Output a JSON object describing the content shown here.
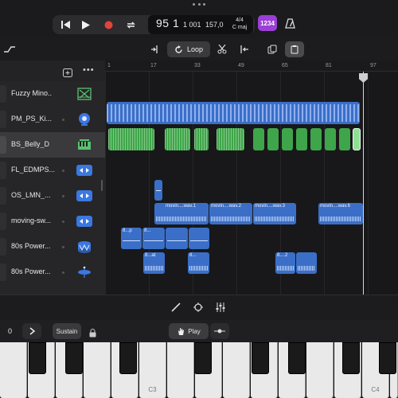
{
  "app": {
    "lcd": {
      "position": "95 1",
      "sub_beat": "1 001",
      "tempo": "157,0",
      "signature_top": "4/4",
      "signature_key": "C maj"
    },
    "count_in_label": "1234"
  },
  "toolbar": {
    "loop_label": "Loop"
  },
  "tracks": [
    {
      "name": "Fuzzy Mino..",
      "icon": "synth-icon"
    },
    {
      "name": "PM_PS_Ki...",
      "icon": "drum-machine-icon"
    },
    {
      "name": "BS_Belly_D",
      "icon": "keyboard-icon"
    },
    {
      "name": "FL_EDMPS...",
      "icon": "audio-waveform-icon"
    },
    {
      "name": "OS_LMN_...",
      "icon": "audio-waveform-icon"
    },
    {
      "name": "moving-sw...",
      "icon": "audio-waveform-icon"
    },
    {
      "name": "80s Power...",
      "icon": "snare-drum-icon"
    },
    {
      "name": "80s Power...",
      "icon": "cymbal-icon"
    }
  ],
  "ruler": [
    "1",
    "17",
    "33",
    "49",
    "65",
    "81",
    "97"
  ],
  "regions": {
    "moving": [
      "movin....wav.1",
      "movin....wav.2",
      "movin....wav.3",
      "movin....wav.6"
    ],
    "power1": [
      "8...p",
      "8..."
    ],
    "power2": [
      "8...at",
      "8...",
      "8....2"
    ]
  },
  "keyboard_controls": {
    "octave_value": "0",
    "sustain_label": "Sustain",
    "play_label": "Play"
  },
  "keyboard": {
    "c3_label": "C3",
    "c4_label": "C4"
  },
  "colors": {
    "accent_purple": "#9b3fd6",
    "region_blue": "#3b6fc7",
    "region_green": "#3fa54a",
    "record_red": "#e0453a"
  }
}
